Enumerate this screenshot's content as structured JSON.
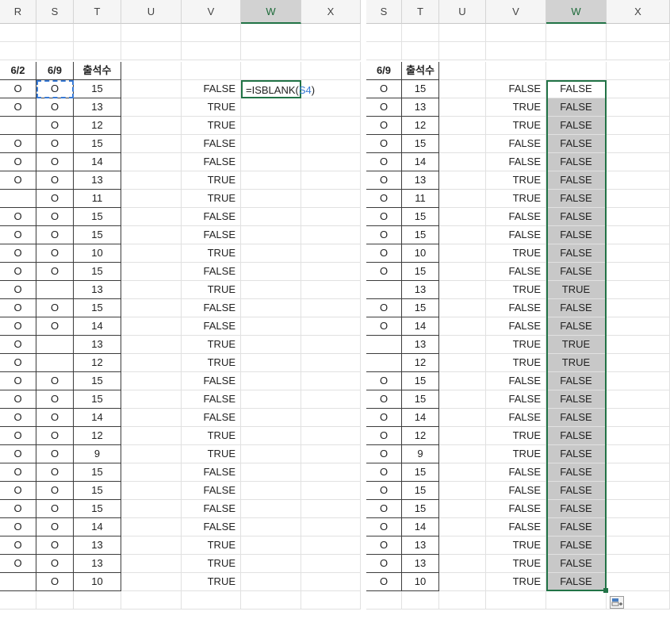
{
  "left": {
    "columns": [
      "R",
      "S",
      "T",
      "U",
      "V",
      "W",
      "X"
    ],
    "selected_column": "W",
    "headers": {
      "r": "6/2",
      "s": "6/9",
      "t": "출석수"
    },
    "formula": {
      "prefix": "=ISBLANK(",
      "ref": "S4",
      "suffix": ")"
    },
    "rows": [
      {
        "r": "O",
        "s": "O",
        "t": "15",
        "v": "FALSE"
      },
      {
        "r": "O",
        "s": "O",
        "t": "13",
        "v": "TRUE"
      },
      {
        "r": "",
        "s": "O",
        "t": "12",
        "v": "TRUE"
      },
      {
        "r": "O",
        "s": "O",
        "t": "15",
        "v": "FALSE"
      },
      {
        "r": "O",
        "s": "O",
        "t": "14",
        "v": "FALSE"
      },
      {
        "r": "O",
        "s": "O",
        "t": "13",
        "v": "TRUE"
      },
      {
        "r": "",
        "s": "O",
        "t": "11",
        "v": "TRUE"
      },
      {
        "r": "O",
        "s": "O",
        "t": "15",
        "v": "FALSE"
      },
      {
        "r": "O",
        "s": "O",
        "t": "15",
        "v": "FALSE"
      },
      {
        "r": "O",
        "s": "O",
        "t": "10",
        "v": "TRUE"
      },
      {
        "r": "O",
        "s": "O",
        "t": "15",
        "v": "FALSE"
      },
      {
        "r": "O",
        "s": "",
        "t": "13",
        "v": "TRUE"
      },
      {
        "r": "O",
        "s": "O",
        "t": "15",
        "v": "FALSE"
      },
      {
        "r": "O",
        "s": "O",
        "t": "14",
        "v": "FALSE"
      },
      {
        "r": "O",
        "s": "",
        "t": "13",
        "v": "TRUE"
      },
      {
        "r": "O",
        "s": "",
        "t": "12",
        "v": "TRUE"
      },
      {
        "r": "O",
        "s": "O",
        "t": "15",
        "v": "FALSE"
      },
      {
        "r": "O",
        "s": "O",
        "t": "15",
        "v": "FALSE"
      },
      {
        "r": "O",
        "s": "O",
        "t": "14",
        "v": "FALSE"
      },
      {
        "r": "O",
        "s": "O",
        "t": "12",
        "v": "TRUE"
      },
      {
        "r": "O",
        "s": "O",
        "t": "9",
        "v": "TRUE"
      },
      {
        "r": "O",
        "s": "O",
        "t": "15",
        "v": "FALSE"
      },
      {
        "r": "O",
        "s": "O",
        "t": "15",
        "v": "FALSE"
      },
      {
        "r": "O",
        "s": "O",
        "t": "15",
        "v": "FALSE"
      },
      {
        "r": "O",
        "s": "O",
        "t": "14",
        "v": "FALSE"
      },
      {
        "r": "O",
        "s": "O",
        "t": "13",
        "v": "TRUE"
      },
      {
        "r": "O",
        "s": "O",
        "t": "13",
        "v": "TRUE"
      },
      {
        "r": "",
        "s": "O",
        "t": "10",
        "v": "TRUE"
      }
    ]
  },
  "right": {
    "columns": [
      "S",
      "T",
      "U",
      "V",
      "W",
      "X"
    ],
    "selected_column": "W",
    "headers": {
      "s": "6/9",
      "t": "출석수"
    },
    "rows": [
      {
        "s": "O",
        "t": "15",
        "v": "FALSE",
        "w": "FALSE"
      },
      {
        "s": "O",
        "t": "13",
        "v": "TRUE",
        "w": "FALSE"
      },
      {
        "s": "O",
        "t": "12",
        "v": "TRUE",
        "w": "FALSE"
      },
      {
        "s": "O",
        "t": "15",
        "v": "FALSE",
        "w": "FALSE"
      },
      {
        "s": "O",
        "t": "14",
        "v": "FALSE",
        "w": "FALSE"
      },
      {
        "s": "O",
        "t": "13",
        "v": "TRUE",
        "w": "FALSE"
      },
      {
        "s": "O",
        "t": "11",
        "v": "TRUE",
        "w": "FALSE"
      },
      {
        "s": "O",
        "t": "15",
        "v": "FALSE",
        "w": "FALSE"
      },
      {
        "s": "O",
        "t": "15",
        "v": "FALSE",
        "w": "FALSE"
      },
      {
        "s": "O",
        "t": "10",
        "v": "TRUE",
        "w": "FALSE"
      },
      {
        "s": "O",
        "t": "15",
        "v": "FALSE",
        "w": "FALSE"
      },
      {
        "s": "",
        "t": "13",
        "v": "TRUE",
        "w": "TRUE"
      },
      {
        "s": "O",
        "t": "15",
        "v": "FALSE",
        "w": "FALSE"
      },
      {
        "s": "O",
        "t": "14",
        "v": "FALSE",
        "w": "FALSE"
      },
      {
        "s": "",
        "t": "13",
        "v": "TRUE",
        "w": "TRUE"
      },
      {
        "s": "",
        "t": "12",
        "v": "TRUE",
        "w": "TRUE"
      },
      {
        "s": "O",
        "t": "15",
        "v": "FALSE",
        "w": "FALSE"
      },
      {
        "s": "O",
        "t": "15",
        "v": "FALSE",
        "w": "FALSE"
      },
      {
        "s": "O",
        "t": "14",
        "v": "FALSE",
        "w": "FALSE"
      },
      {
        "s": "O",
        "t": "12",
        "v": "TRUE",
        "w": "FALSE"
      },
      {
        "s": "O",
        "t": "9",
        "v": "TRUE",
        "w": "FALSE"
      },
      {
        "s": "O",
        "t": "15",
        "v": "FALSE",
        "w": "FALSE"
      },
      {
        "s": "O",
        "t": "15",
        "v": "FALSE",
        "w": "FALSE"
      },
      {
        "s": "O",
        "t": "15",
        "v": "FALSE",
        "w": "FALSE"
      },
      {
        "s": "O",
        "t": "14",
        "v": "FALSE",
        "w": "FALSE"
      },
      {
        "s": "O",
        "t": "13",
        "v": "TRUE",
        "w": "FALSE"
      },
      {
        "s": "O",
        "t": "13",
        "v": "TRUE",
        "w": "FALSE"
      },
      {
        "s": "O",
        "t": "10",
        "v": "TRUE",
        "w": "FALSE"
      }
    ]
  },
  "quick_analysis_icon": "paste-options-icon"
}
